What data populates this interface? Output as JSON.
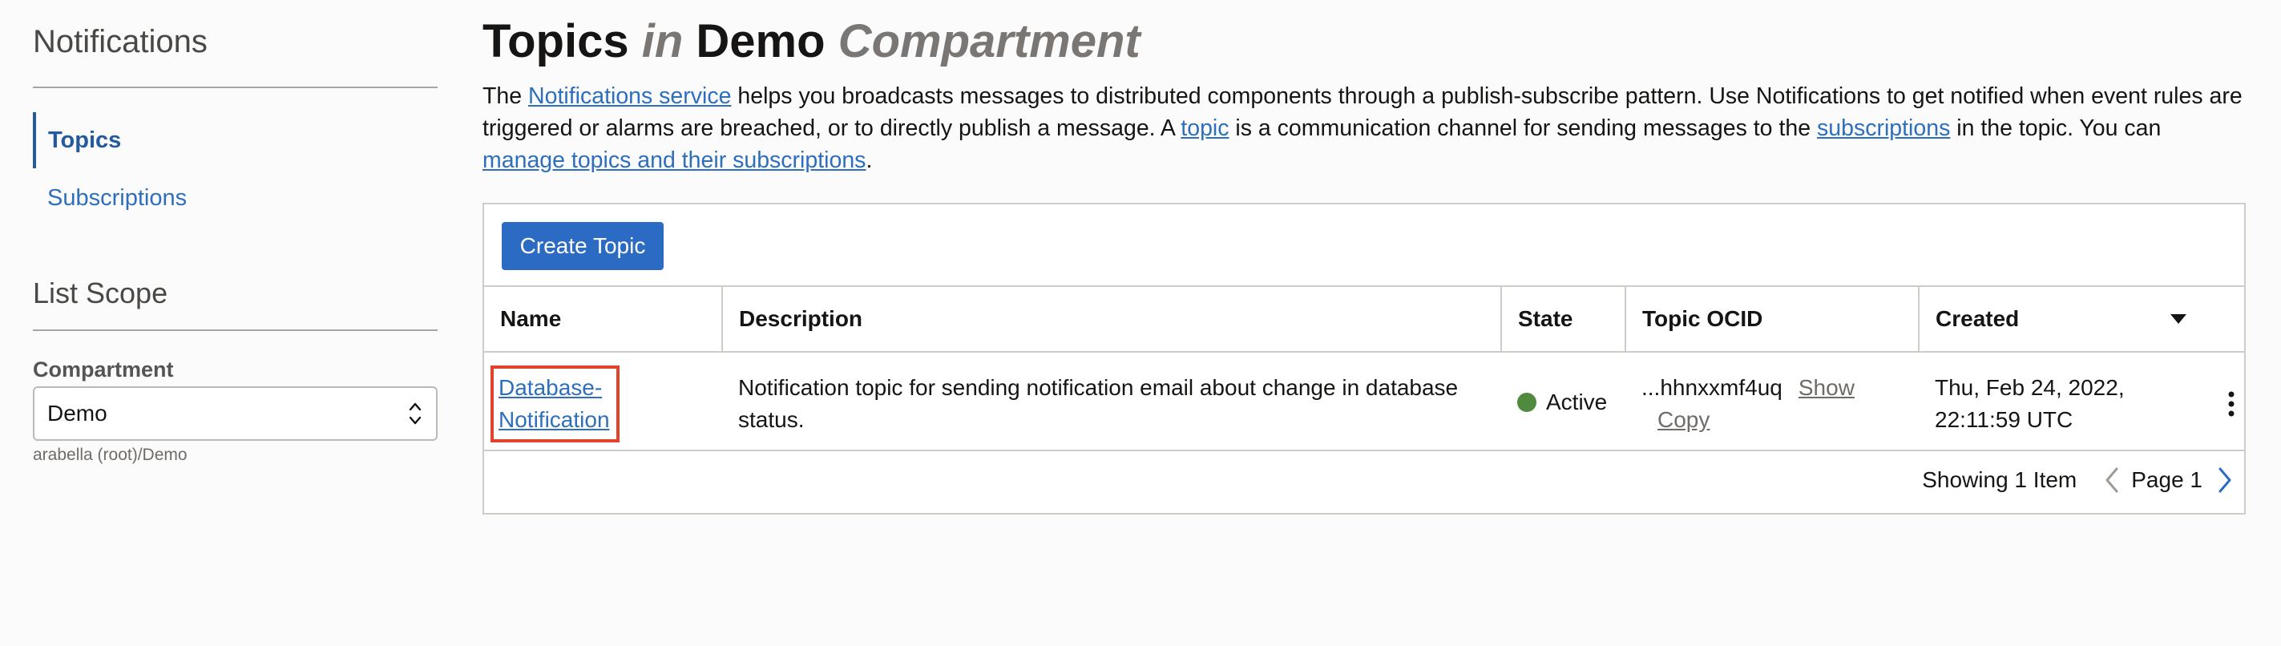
{
  "sidebar": {
    "title": "Notifications",
    "items": [
      {
        "label": "Topics"
      },
      {
        "label": "Subscriptions"
      }
    ],
    "list_scope": {
      "title": "List Scope",
      "compartment_label": "Compartment",
      "compartment_value": "Demo",
      "compartment_path": "arabella (root)/Demo"
    }
  },
  "header": {
    "title_topics": "Topics",
    "title_in": "in",
    "title_compartment_name": "Demo",
    "title_compartment_word": "Compartment"
  },
  "intro": {
    "t1": "The ",
    "link1": "Notifications service",
    "t2": " helps you broadcasts messages to distributed components through a publish-subscribe pattern. Use Notifications to get notified when event rules are triggered or alarms are breached, or to directly publish a message. A ",
    "link2": "topic",
    "t3": " is a communication channel for sending messages to the ",
    "link3": "subscriptions",
    "t4": " in the topic. You can ",
    "link4": "manage topics and their subscriptions",
    "t5": "."
  },
  "toolbar": {
    "create_label": "Create Topic"
  },
  "table": {
    "columns": [
      "Name",
      "Description",
      "State",
      "Topic OCID",
      "Created"
    ],
    "rows": [
      {
        "name": "Database-Notification",
        "name_line1": "Database-",
        "name_line2": "Notification",
        "description": "Notification topic for sending notification email about change in database status.",
        "state": "Active",
        "ocid": "...hhnxxmf4uq",
        "ocid_show": "Show",
        "ocid_copy": "Copy",
        "created_line1": "Thu, Feb 24, 2022,",
        "created_line2": "22:11:59 UTC"
      }
    ]
  },
  "pagination": {
    "count": "Showing 1 Item",
    "page": "Page 1"
  },
  "colors": {
    "accent": "#2b6bc4",
    "link": "#2d6fbd",
    "active": "#508a3e",
    "highlight": "#e0432b"
  },
  "icons": [
    "select-chevrons-icon",
    "sort-caret-icon",
    "status-dot-icon",
    "kebab-menu-icon",
    "chevron-left-icon",
    "chevron-right-icon"
  ]
}
